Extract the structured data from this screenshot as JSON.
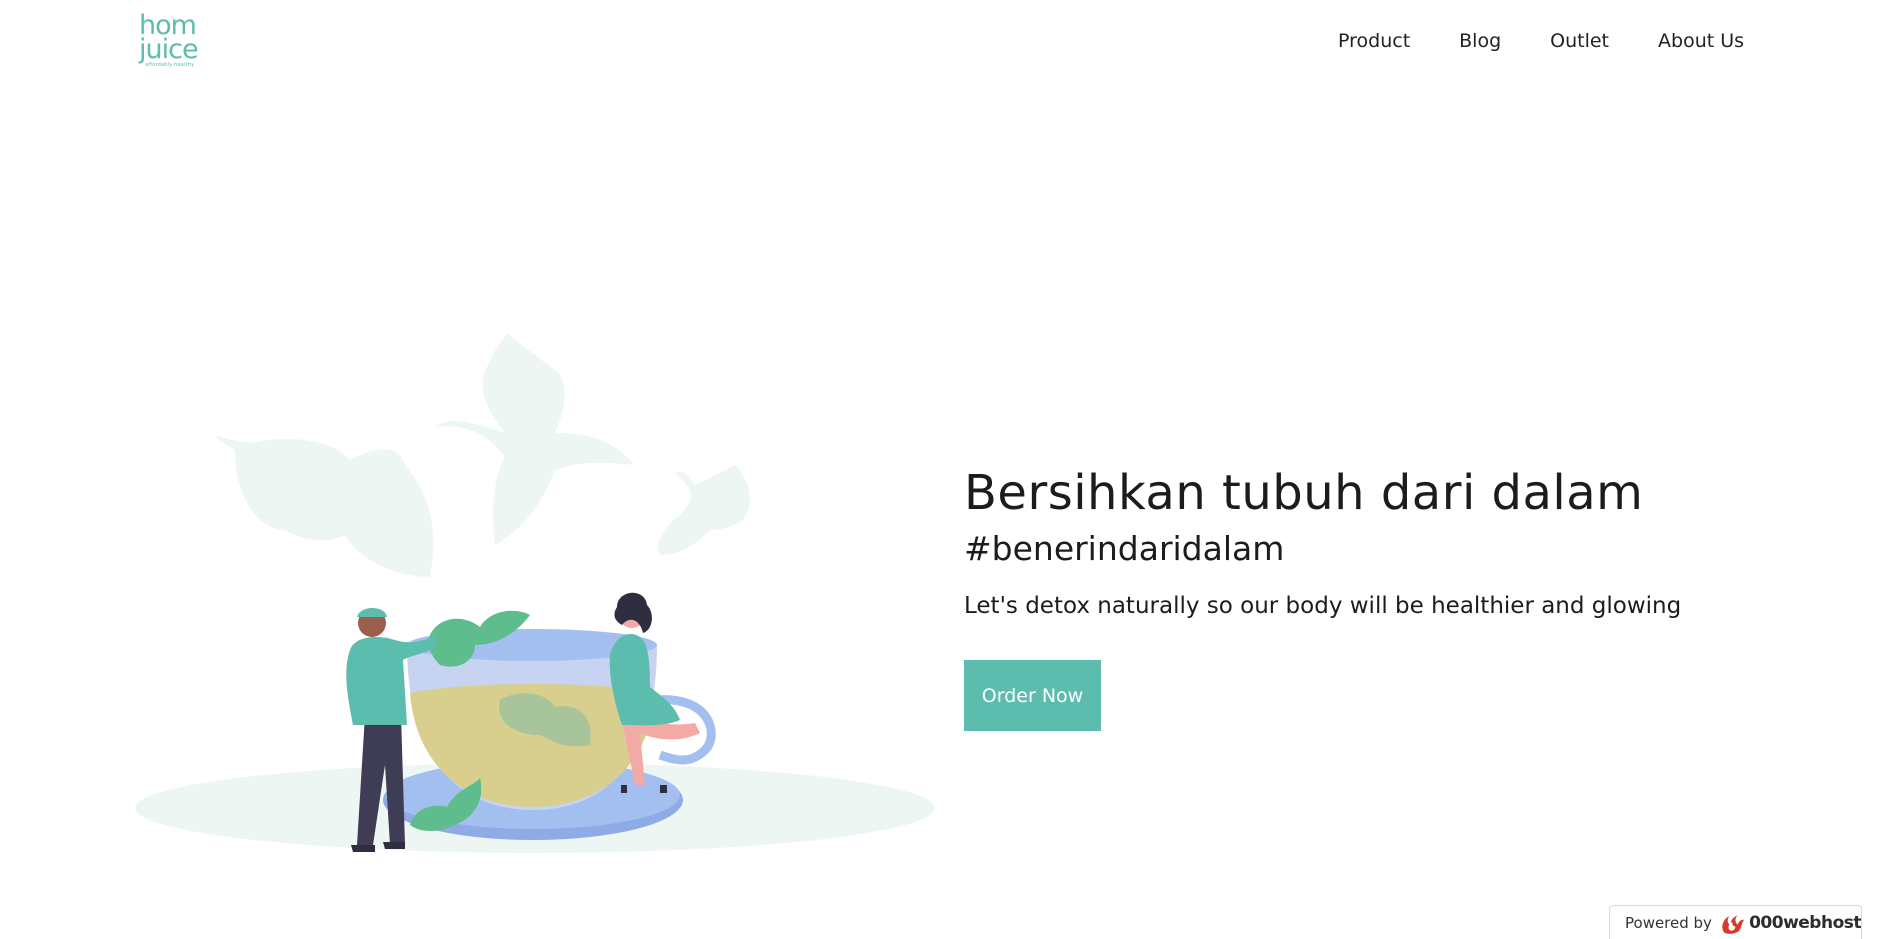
{
  "header": {
    "logo_line1": "hom",
    "logo_line2": "juice",
    "logo_tagline": "affordably healthy",
    "nav": [
      {
        "label": "Product"
      },
      {
        "label": "Blog"
      },
      {
        "label": "Outlet"
      },
      {
        "label": "About Us"
      }
    ]
  },
  "hero": {
    "title": "Bersihkan tubuh dari dalam",
    "hashtag": "#benerindaridalam",
    "subtitle": "Let's detox naturally so our body will be healthier and glowing",
    "cta_label": "Order Now"
  },
  "footer_badge": {
    "powered_label": "Powered by",
    "brand": "000webhost"
  },
  "colors": {
    "accent": "#5cbcae",
    "cup": "#a3bff0",
    "tea": "#d8cf8f",
    "leaf": "#5fbc8c",
    "mist": "#eef6f4"
  },
  "icons": {
    "badge_logo": "000webhost-flame-icon"
  }
}
